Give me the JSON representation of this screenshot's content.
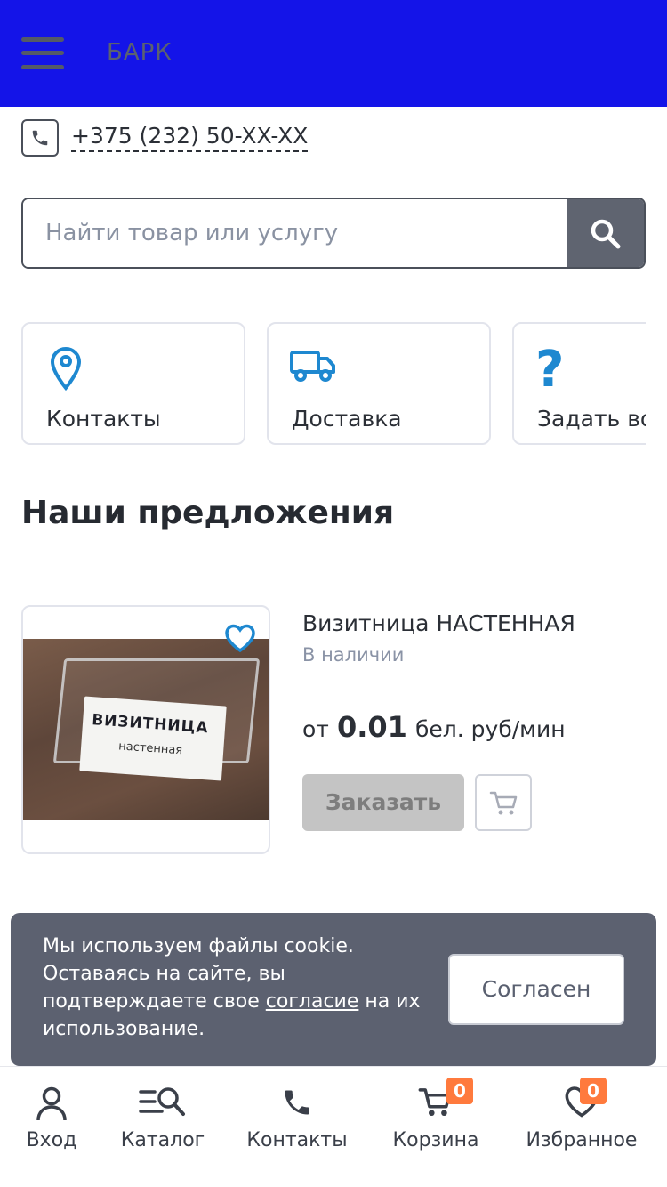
{
  "header": {
    "brand": "БАРК",
    "menu_icon": "hamburger-menu-icon",
    "background": "#1414e8"
  },
  "contact": {
    "phone": "+375 (232) 50-XX-XX",
    "icon": "phone-icon"
  },
  "search": {
    "placeholder": "Найти товар или услугу",
    "value": "",
    "icon": "search-icon"
  },
  "quick_links": [
    {
      "label": "Контакты",
      "icon": "map-pin-icon"
    },
    {
      "label": "Доставка",
      "icon": "truck-icon"
    },
    {
      "label": "Задать вопрос",
      "icon": "question-icon"
    }
  ],
  "section": {
    "title": "Наши предложения"
  },
  "product": {
    "name": "Визитница НАСТЕННАЯ",
    "stock": "В наличии",
    "price_prefix": "от",
    "price": "0.01",
    "price_unit": "бел. руб/мин",
    "order_label": "Заказать",
    "image_text_main": "ВИЗИТНИЦА",
    "image_text_sub": "настенная",
    "favorite_icon": "heart-icon",
    "cart_icon": "cart-icon"
  },
  "cookie": {
    "text_before": "Мы используем файлы cookie. Оставаясь на сайте, вы подтверждаете свое ",
    "link": "согласие",
    "text_after": " на их использование.",
    "accept_label": "Согласен"
  },
  "bottom_nav": [
    {
      "label": "Вход",
      "icon": "user-icon"
    },
    {
      "label": "Каталог",
      "icon": "catalog-search-icon"
    },
    {
      "label": "Контакты",
      "icon": "phone-icon"
    },
    {
      "label": "Корзина",
      "icon": "cart-icon",
      "badge": "0"
    },
    {
      "label": "Избранное",
      "icon": "heart-icon",
      "badge": "0"
    }
  ],
  "colors": {
    "accent_blue": "#1e88d0",
    "badge_orange": "#ff7a3d",
    "cookie_bg": "#5c6170"
  }
}
